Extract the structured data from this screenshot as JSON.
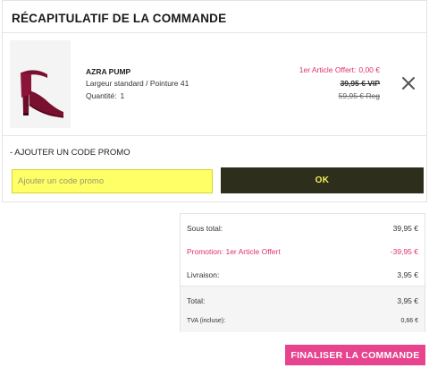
{
  "order": {
    "title": "RÉCAPITULATIF DE LA COMMANDE"
  },
  "product": {
    "name": "AZRA PUMP",
    "size": "Largeur standard / Pointure 41",
    "quantity_label": "Quantité:",
    "quantity": "1",
    "offer_label": "1er Article Offert:",
    "offer_price": "0,00 €",
    "vip_price": "39,95 € VIP",
    "reg_price": "59,95 € Reg",
    "image_icon": "burgundy-heel-pump",
    "remove_icon": "close-icon"
  },
  "promo": {
    "title": "- AJOUTER UN CODE PROMO",
    "placeholder": "Ajouter un code promo",
    "value": "",
    "button_label": "OK"
  },
  "summary": {
    "rows": [
      {
        "label": "Sous total:",
        "value": "39,95 €"
      },
      {
        "label": "Promotion: 1er Article Offert",
        "value": "-39,95 €"
      },
      {
        "label": "Livraison:",
        "value": "3,95 €"
      },
      {
        "label": "Total:",
        "value": "3,95 €"
      },
      {
        "label": "TVA (incluse):",
        "value": "0,66 €"
      }
    ]
  },
  "checkout": {
    "button_label": "FINALISER LA COMMANDE"
  },
  "colors": {
    "accent_pink": "#e8438f",
    "promo_text_pink": "#e0306c",
    "input_highlight": "#ffff66",
    "ok_button_bg": "#2e2e1c",
    "ok_button_text": "#f0f05a",
    "shoe_burgundy": "#7a1030"
  }
}
